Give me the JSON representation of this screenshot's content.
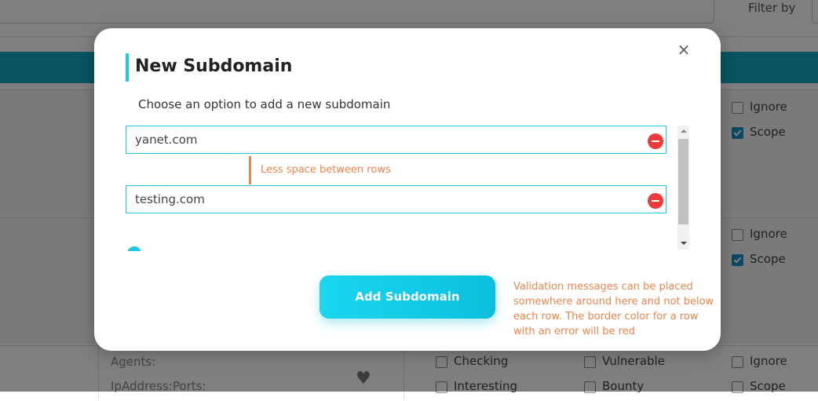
{
  "background": {
    "filter_label": "Filter by",
    "row1": {
      "ignore": "Ignore",
      "scope": "Scope"
    },
    "row2": {
      "ignore": "Ignore",
      "scope": "Scope"
    },
    "row3": {
      "agents": "Agents:",
      "ipaddress": "IpAddress:",
      "ports": "Ports:",
      "checking": "Checking",
      "interesting": "Interesting",
      "vulnerable": "Vulnerable",
      "bounty": "Bounty",
      "ignore": "Ignore",
      "scope": "Scope"
    }
  },
  "modal": {
    "title": "New Subdomain",
    "close_icon": "×",
    "subtitle": "Choose an option to add a new subdomain",
    "fields": [
      {
        "value": "yanet.com"
      },
      {
        "value": "testing.com"
      }
    ],
    "annotation_rows": "Less space between rows",
    "annotation_validation": [
      "Validation messages can be placed",
      "somewhere around here and not below",
      "each row. The border color for a row",
      "with an error will be red"
    ],
    "add_button": "Add Subdomain"
  },
  "colors": {
    "accent": "#1ec6e0",
    "remove": "#ee3a3a",
    "annotation": "#f0834a",
    "teal_bar": "#12a8c0"
  }
}
